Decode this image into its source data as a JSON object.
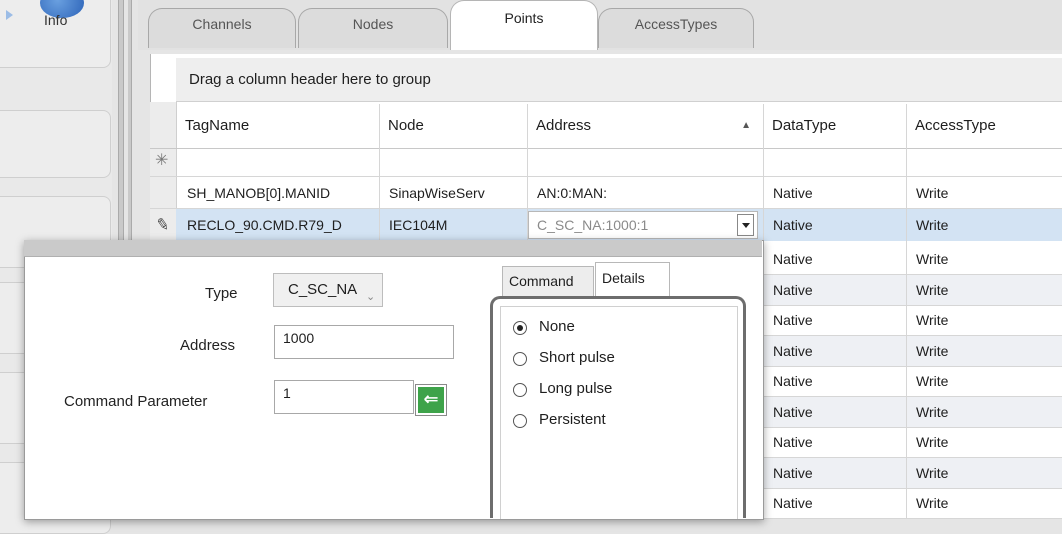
{
  "sidebar": {
    "info_label": "Info"
  },
  "tabs": [
    {
      "label": "Channels"
    },
    {
      "label": "Nodes"
    },
    {
      "label": "Points"
    },
    {
      "label": "AccessTypes"
    }
  ],
  "grid": {
    "group_hint": "Drag a column header here to group",
    "columns": [
      "TagName",
      "Node",
      "Address",
      "DataType",
      "AccessType"
    ],
    "sort_column": "Address",
    "rows": [
      {
        "tag": "SH_MANOB[0].MANID",
        "node": "SinapWiseServ",
        "address": "AN:0:MAN:",
        "datatype": "Native",
        "access": "Write"
      },
      {
        "tag": "RECLO_90.CMD.R79_D",
        "node": "IEC104M",
        "address": "C_SC_NA:1000:1",
        "datatype": "Native",
        "access": "Write"
      }
    ],
    "more_rows": [
      {
        "datatype": "Native",
        "access": "Write"
      },
      {
        "datatype": "Native",
        "access": "Write"
      },
      {
        "datatype": "Native",
        "access": "Write"
      },
      {
        "datatype": "Native",
        "access": "Write"
      },
      {
        "datatype": "Native",
        "access": "Write"
      },
      {
        "datatype": "Native",
        "access": "Write"
      },
      {
        "datatype": "Native",
        "access": "Write"
      },
      {
        "datatype": "Native",
        "access": "Write"
      },
      {
        "datatype": "Native",
        "access": "Write"
      }
    ]
  },
  "editor": {
    "type_label": "Type",
    "type_value": "C_SC_NA",
    "address_label": "Address",
    "address_value": "1000",
    "param_label": "Command Parameter",
    "param_value": "1",
    "tabs": [
      "Command",
      "Details"
    ],
    "options": [
      "None",
      "Short pulse",
      "Long pulse",
      "Persistent"
    ],
    "selected_option": "None"
  },
  "colors": {
    "selected_row": "#d3e3f3",
    "go_button": "#3ea34a"
  }
}
